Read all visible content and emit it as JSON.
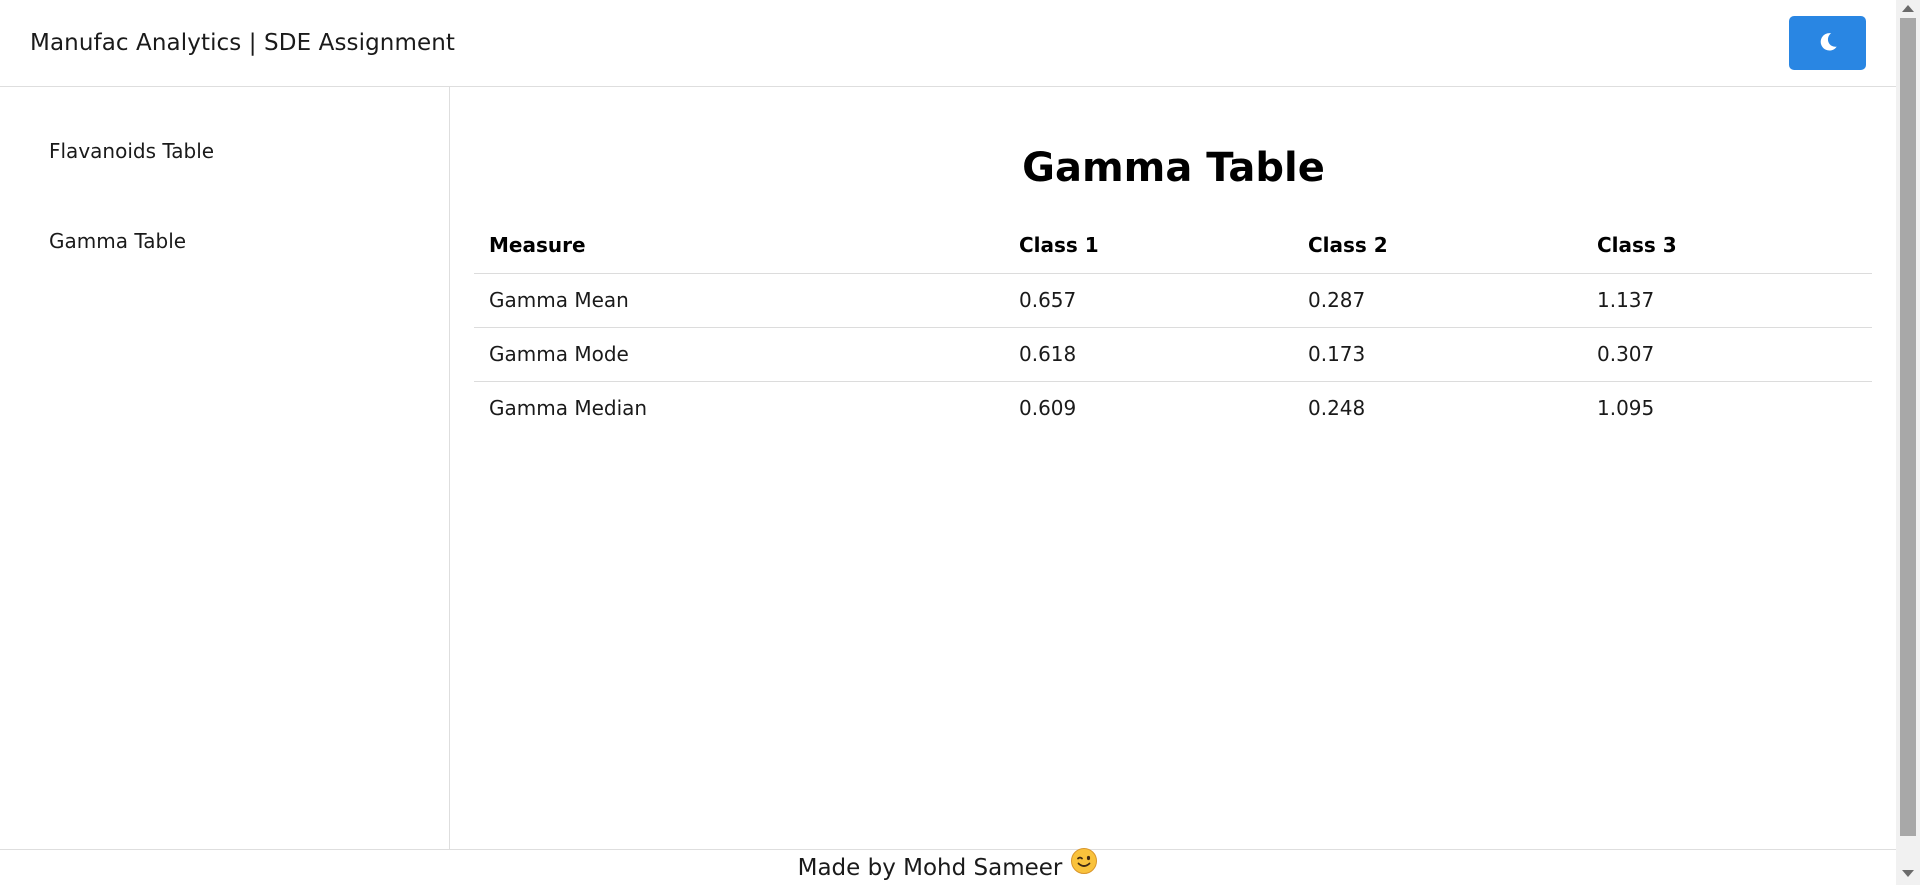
{
  "header": {
    "title": "Manufac Analytics | SDE Assignment",
    "theme_toggle_icon": "moon-icon",
    "accent_color": "#2986e3"
  },
  "sidebar": {
    "items": [
      {
        "label": "Flavanoids Table"
      },
      {
        "label": "Gamma Table"
      }
    ]
  },
  "main": {
    "title": "Gamma Table",
    "table": {
      "headers": [
        "Measure",
        "Class 1",
        "Class 2",
        "Class 3"
      ],
      "rows": [
        [
          "Gamma Mean",
          "0.657",
          "0.287",
          "1.137"
        ],
        [
          "Gamma Mode",
          "0.618",
          "0.173",
          "0.307"
        ],
        [
          "Gamma Median",
          "0.609",
          "0.248",
          "1.095"
        ]
      ]
    }
  },
  "footer": {
    "text": "Made by Mohd Sameer",
    "emoji_icon": "winking-face-icon"
  }
}
